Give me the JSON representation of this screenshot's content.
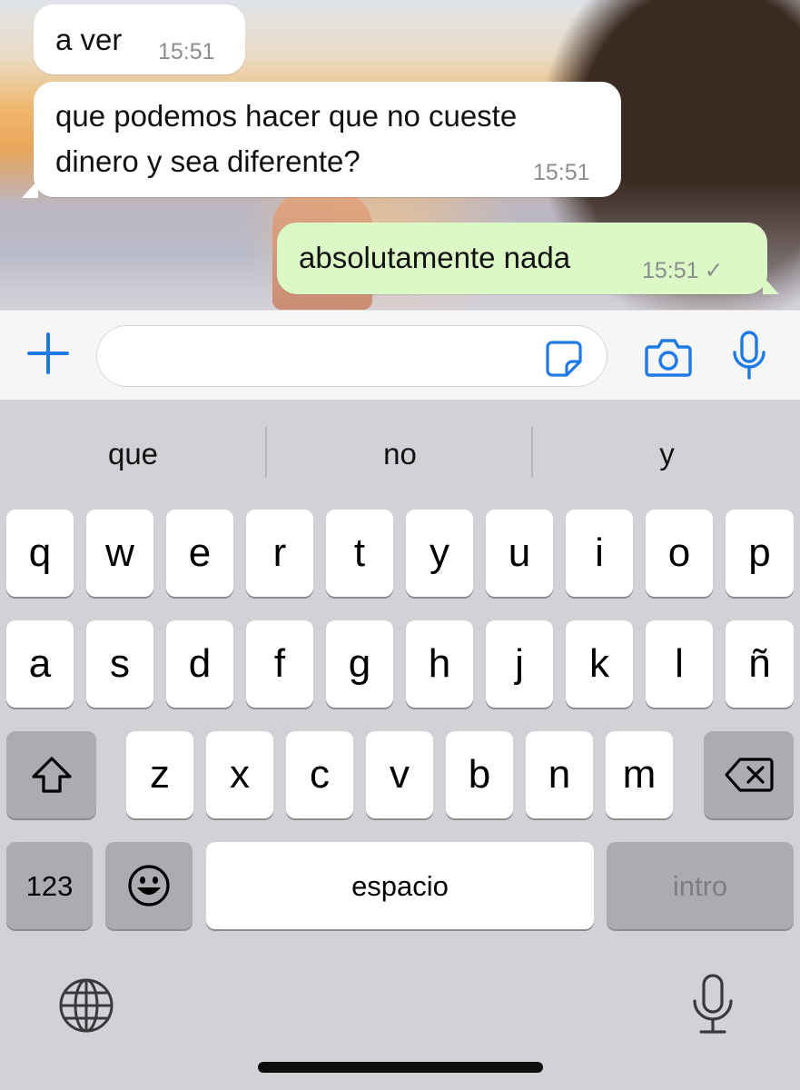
{
  "messages": [
    {
      "direction": "in",
      "text_lines": [
        "a ver"
      ],
      "time": "15:51"
    },
    {
      "direction": "in",
      "text_lines": [
        "que podemos hacer que no cueste",
        "dinero y sea diferente?"
      ],
      "time": "15:51"
    },
    {
      "direction": "out",
      "text_lines": [
        "absolutamente nada"
      ],
      "time": "15:51",
      "status": "✓"
    }
  ],
  "composer": {
    "placeholder": ""
  },
  "suggestions": [
    "que",
    "no",
    "y"
  ],
  "keyboard": {
    "row1": [
      "q",
      "w",
      "e",
      "r",
      "t",
      "y",
      "u",
      "i",
      "o",
      "p"
    ],
    "row2": [
      "a",
      "s",
      "d",
      "f",
      "g",
      "h",
      "j",
      "k",
      "l",
      "ñ"
    ],
    "row3": [
      "z",
      "x",
      "c",
      "v",
      "b",
      "n",
      "m"
    ],
    "numbers_label": "123",
    "space_label": "espacio",
    "return_label": "intro"
  },
  "colors": {
    "accent": "#1f7ae6",
    "incoming_bubble": "#ffffff",
    "outgoing_bubble": "#dcf8c6"
  },
  "icons": [
    "plus-icon",
    "sticker-icon",
    "camera-icon",
    "microphone-icon",
    "shift-icon",
    "backspace-icon",
    "emoji-icon",
    "globe-icon",
    "dictation-icon"
  ]
}
